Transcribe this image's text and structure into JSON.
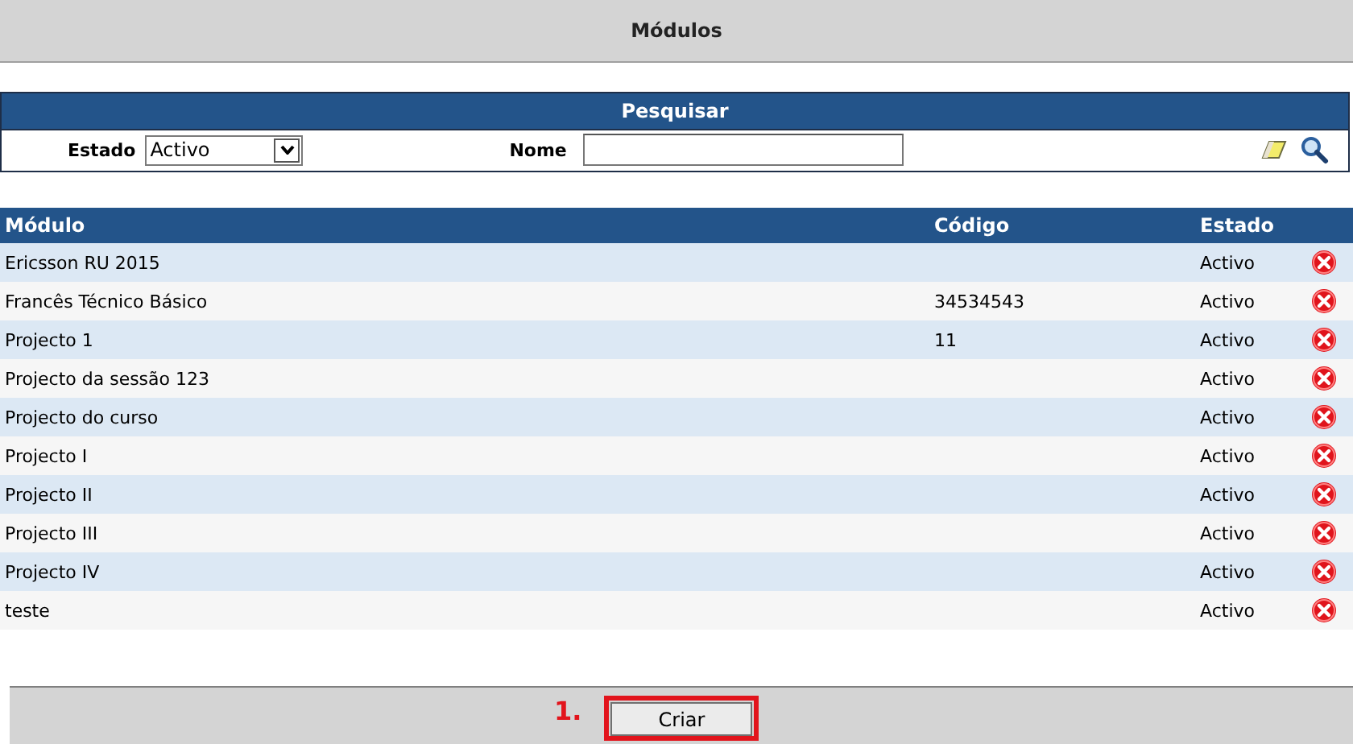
{
  "page_title": "Módulos",
  "search": {
    "title": "Pesquisar",
    "estado_label": "Estado",
    "estado_value": "Activo",
    "nome_label": "Nome"
  },
  "table": {
    "columns": [
      "Módulo",
      "Código",
      "Estado"
    ],
    "rows": [
      {
        "modulo": "Ericsson RU 2015",
        "codigo": "",
        "estado": "Activo"
      },
      {
        "modulo": "Francês Técnico Básico",
        "codigo": "34534543",
        "estado": "Activo"
      },
      {
        "modulo": "Projecto 1",
        "codigo": "11",
        "estado": "Activo"
      },
      {
        "modulo": "Projecto da sessão 123",
        "codigo": "",
        "estado": "Activo"
      },
      {
        "modulo": "Projecto do curso",
        "codigo": "",
        "estado": "Activo"
      },
      {
        "modulo": "Projecto I",
        "codigo": "",
        "estado": "Activo"
      },
      {
        "modulo": "Projecto II",
        "codigo": "",
        "estado": "Activo"
      },
      {
        "modulo": "Projecto III",
        "codigo": "",
        "estado": "Activo"
      },
      {
        "modulo": "Projecto IV",
        "codigo": "",
        "estado": "Activo"
      },
      {
        "modulo": "teste",
        "codigo": "",
        "estado": "Activo"
      }
    ]
  },
  "footer": {
    "annotation": "1.",
    "button": "Criar"
  }
}
